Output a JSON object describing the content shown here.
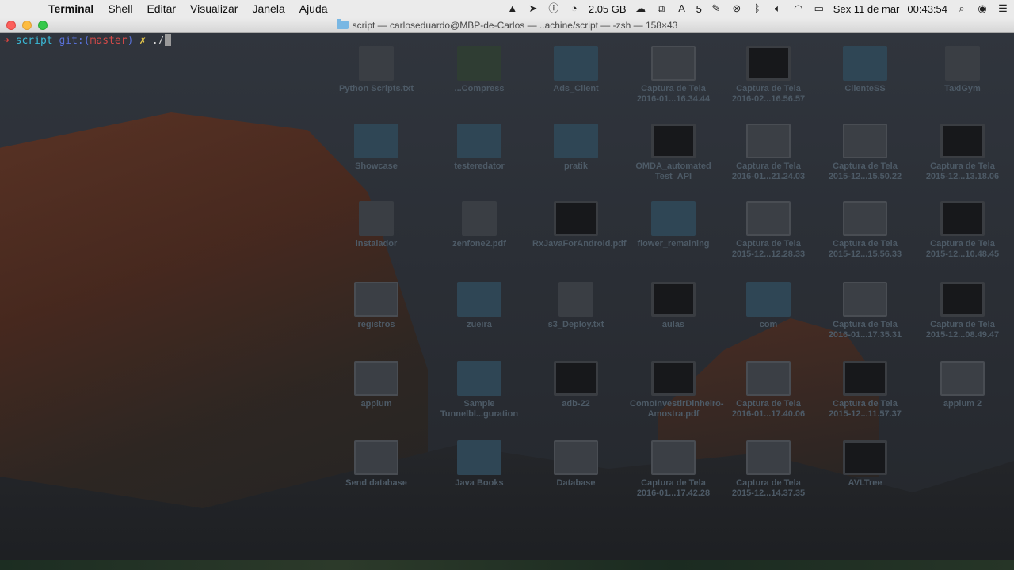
{
  "menubar": {
    "app_name": "Terminal",
    "menus": [
      "Shell",
      "Editar",
      "Visualizar",
      "Janela",
      "Ajuda"
    ],
    "memory": "2.05 GB",
    "notification_count": "5",
    "datetime_day": "Sex 11 de mar",
    "datetime_time": "00:43:54"
  },
  "window": {
    "title": "script — carloseduardo@MBP-de-Carlos — ..achine/script — -zsh — 158×43"
  },
  "terminal": {
    "prompt_arrow": "➜",
    "dir": "script",
    "git_label": "git:",
    "branch_open": "(",
    "branch": "master",
    "branch_close": ")",
    "dirty": "✗",
    "command": "./"
  },
  "desktop_icons": [
    {
      "label": "Python Scripts.txt",
      "type": "file"
    },
    {
      "label": "...Compress",
      "type": "rar"
    },
    {
      "label": "Ads_Client",
      "type": "folder"
    },
    {
      "label": "Captura de Tela 2016-01...16.34.44",
      "type": "img"
    },
    {
      "label": "Captura de Tela 2016-02...16.56.57",
      "type": "dark"
    },
    {
      "label": "ClienteSS",
      "type": "folder"
    },
    {
      "label": "TaxiGym",
      "type": "file"
    },
    {
      "label": "Showcase",
      "type": "folder"
    },
    {
      "label": "testeredator",
      "type": "folder"
    },
    {
      "label": "pratik",
      "type": "folder"
    },
    {
      "label": "OMDA_automated Test_API",
      "type": "dark"
    },
    {
      "label": "Captura de Tela 2016-01...21.24.03",
      "type": "img"
    },
    {
      "label": "Captura de Tela 2015-12...15.50.22",
      "type": "img"
    },
    {
      "label": "Captura de Tela 2015-12...13.18.06",
      "type": "dark"
    },
    {
      "label": "instalador",
      "type": "file"
    },
    {
      "label": "zenfone2.pdf",
      "type": "file"
    },
    {
      "label": "RxJavaForAndroid.pdf",
      "type": "dark"
    },
    {
      "label": "flower_remaining",
      "type": "folder"
    },
    {
      "label": "Captura de Tela 2015-12...12.28.33",
      "type": "img"
    },
    {
      "label": "Captura de Tela 2015-12...15.56.33",
      "type": "img"
    },
    {
      "label": "Captura de Tela 2015-12...10.48.45",
      "type": "dark"
    },
    {
      "label": "registros",
      "type": "img"
    },
    {
      "label": "zueira",
      "type": "folder"
    },
    {
      "label": "s3_Deploy.txt",
      "type": "file"
    },
    {
      "label": "aulas",
      "type": "dark"
    },
    {
      "label": "com",
      "type": "folder"
    },
    {
      "label": "Captura de Tela 2016-01...17.35.31",
      "type": "img"
    },
    {
      "label": "Captura de Tela 2015-12...08.49.47",
      "type": "dark"
    },
    {
      "label": "appium",
      "type": "img"
    },
    {
      "label": "Sample Tunnelbl...guration",
      "type": "folder"
    },
    {
      "label": "adb-22",
      "type": "dark"
    },
    {
      "label": "ComoInvestirDinheiro-Amostra.pdf",
      "type": "dark"
    },
    {
      "label": "Captura de Tela 2016-01...17.40.06",
      "type": "img"
    },
    {
      "label": "Captura de Tela 2015-12...11.57.37",
      "type": "dark"
    },
    {
      "label": "appium 2",
      "type": "img"
    },
    {
      "label": "Send database",
      "type": "img"
    },
    {
      "label": "Java Books",
      "type": "folder"
    },
    {
      "label": "Database",
      "type": "img"
    },
    {
      "label": "Captura de Tela 2016-01...17.42.28",
      "type": "img"
    },
    {
      "label": "Captura de Tela 2015-12...14.37.35",
      "type": "img"
    },
    {
      "label": "AVLTree",
      "type": "dark"
    }
  ]
}
